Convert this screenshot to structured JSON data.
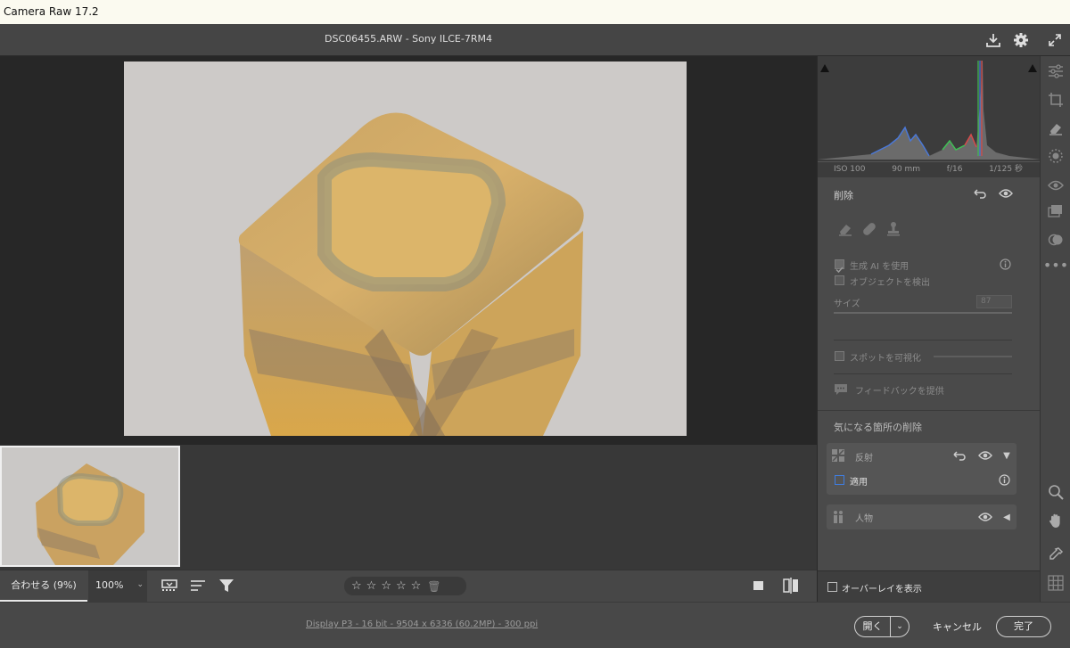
{
  "window": {
    "title": "Camera Raw 17.2"
  },
  "header": {
    "filename": "DSC06455.ARW  -  Sony ILCE-7RM4"
  },
  "exif": {
    "iso": "ISO 100",
    "focal": "90 mm",
    "aperture": "f/16",
    "shutter": "1/125 秒"
  },
  "remove_panel": {
    "title": "削除",
    "generative_ai_label": "生成 AI を使用",
    "detect_objects_label": "オブジェクトを検出",
    "size_label": "サイズ",
    "size_value": "87",
    "visualize_spots_label": "スポットを可視化",
    "feedback_label": "フィードバックを提供"
  },
  "distraction_panel": {
    "title": "気になる箇所の削除",
    "reflections_label": "反射",
    "apply_label": "適用",
    "people_label": "人物"
  },
  "overlay_label": "オーバーレイを表示",
  "bottombar": {
    "fit_label": "合わせる (9%)",
    "zoom_label": "100%"
  },
  "status": {
    "link_text": "Display P3 - 16 bit - 9504 x 6336 (60.2MP) - 300 ppi",
    "open_label": "開く",
    "cancel_label": "キャンセル",
    "done_label": "完了"
  },
  "rating": {
    "stars": 0,
    "max": 5
  },
  "icons": {
    "save": "save-icon",
    "settings": "gear-icon",
    "fullscreen": "expand-icon",
    "edit": "sliders-icon",
    "crop": "crop-icon",
    "remove": "eraser-icon",
    "mask": "mask-icon",
    "redeye": "eye-icon",
    "presets": "presets-icon",
    "more": "ellipsis-icon",
    "zoom": "magnifier-icon",
    "hand": "hand-icon",
    "sampler": "eyedropper-icon",
    "grid": "grid-icon"
  },
  "colors": {
    "panel": "#4a4a4a",
    "accent": "#2f6fd6"
  }
}
